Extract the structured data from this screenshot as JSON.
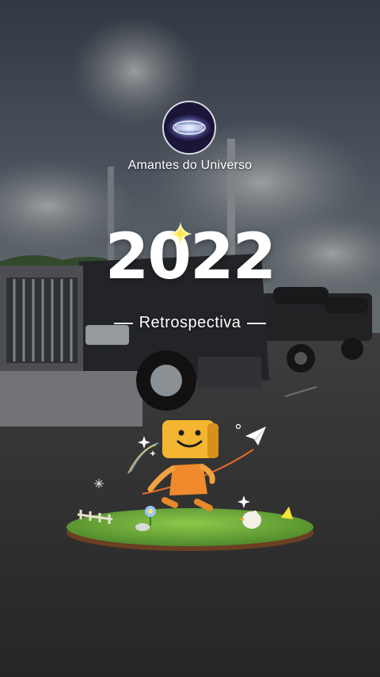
{
  "channel": {
    "name": "Amantes do Universo",
    "avatar_icon": "galaxy-avatar-icon"
  },
  "recap": {
    "year": "2022",
    "subtitle": "Retrospectiva"
  },
  "illustration": {
    "mascot_icon": "smiley-box-mascot-icon",
    "plane_icon": "paper-plane-icon",
    "sparkle_icon": "sparkle-icon"
  },
  "colors": {
    "mascot": "#f2b731",
    "mascot_body": "#f0842a",
    "grass": "#6ea63b",
    "text": "#ffffff"
  }
}
